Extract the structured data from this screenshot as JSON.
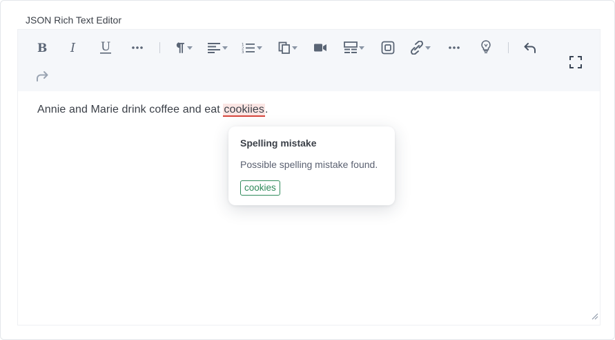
{
  "field": {
    "label": "JSON Rich Text Editor"
  },
  "toolbar": {
    "icons": [
      "bold-icon",
      "italic-icon",
      "underline-icon",
      "more-icon",
      "paragraph-format-icon",
      "align-icon",
      "ordered-list-icon",
      "paste-icon",
      "video-icon",
      "table-icon",
      "embed-icon",
      "link-icon",
      "more-icon",
      "lightbulb-icon",
      "undo-icon",
      "redo-icon",
      "fullscreen-icon"
    ]
  },
  "content": {
    "before": "Annie and Marie drink coffee and eat ",
    "misspelled_word": "cookiies",
    "after": "."
  },
  "popover": {
    "title": "Spelling mistake",
    "message": "Possible spelling mistake found.",
    "suggestion": "cookies"
  },
  "colors": {
    "toolbar_bg": "#f5f7fa",
    "misspelled_underline": "#d6453b",
    "suggestion": "#2f8a5a"
  }
}
